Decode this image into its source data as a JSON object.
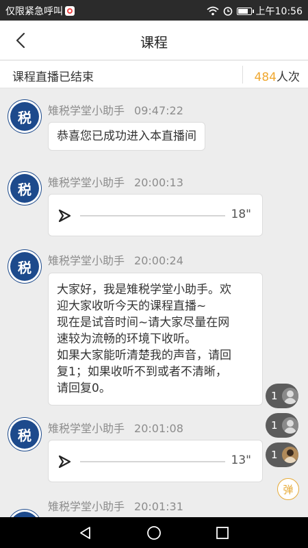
{
  "status_bar": {
    "left_text": "仅限紧急呼叫",
    "clock": "上午10:56",
    "icons": [
      "app-notification-icon",
      "wifi-icon",
      "alarm-icon",
      "battery-icon"
    ]
  },
  "header": {
    "title": "课程",
    "back_icon": "back-chevron-icon"
  },
  "info_bar": {
    "status": "课程直播已结束",
    "view_count": "484",
    "view_unit": "人次"
  },
  "messages": [
    {
      "sender": "雉税学堂小助手",
      "time": "09:47:22",
      "type": "text",
      "text": "恭喜您已成功进入本直播间",
      "avatar_text": "税"
    },
    {
      "sender": "雉税学堂小助手",
      "time": "20:00:13",
      "type": "audio",
      "duration": "18\"",
      "avatar_text": "税"
    },
    {
      "sender": "雉税学堂小助手",
      "time": "20:00:24",
      "type": "text",
      "avatar_text": "税",
      "lines": [
        "大家好，我是雉税学堂小助手。欢",
        "迎大家收听今天的课程直播~",
        "现在是试音时间~请大家尽量在网",
        "速较为流畅的环境下收听。",
        "如果大家能听清楚我的声音，请回",
        "复1；如果收听不到或者不清晰，",
        "请回复0。"
      ]
    },
    {
      "sender": "雉税学堂小助手",
      "time": "20:01:08",
      "type": "audio",
      "duration": "13\"",
      "avatar_text": "税"
    },
    {
      "sender": "雉税学堂小助手",
      "time": "20:01:31",
      "type": "partial",
      "avatar_text": "税"
    }
  ],
  "viewers": [
    {
      "count": "1",
      "avatar": "default-user-icon"
    },
    {
      "count": "1",
      "avatar": "default-user-icon"
    },
    {
      "count": "1",
      "avatar": "user-photo"
    }
  ],
  "danmu_button": "弹",
  "nav_bar": [
    "back-triangle-icon",
    "home-circle-icon",
    "recent-square-icon"
  ],
  "colors": {
    "accent": "#f0a830",
    "avatar_blue": "#1d4a8c",
    "background": "#ededed"
  }
}
